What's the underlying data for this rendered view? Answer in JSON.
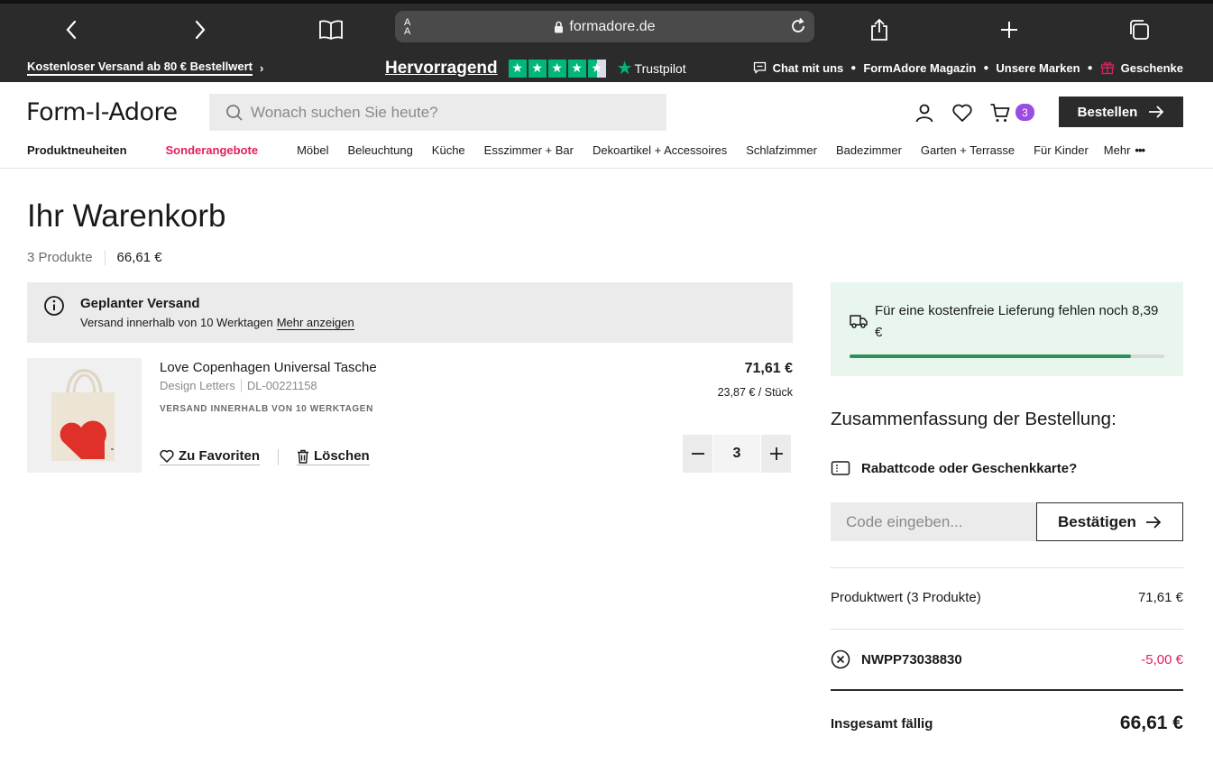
{
  "browser": {
    "url": "formadore.de",
    "aa_label": "A\nA"
  },
  "topbar": {
    "shipping_promo": "Kostenloser Versand ab 80 € Bestellwert",
    "trust_rating": "Hervorragend",
    "trust_brand": "Trustpilot",
    "links": [
      "Chat mit uns",
      "FormAdore Magazin",
      "Unsere Marken",
      "Geschenke"
    ]
  },
  "header": {
    "logo": "Form-I-Adore",
    "search_placeholder": "Wonach suchen Sie heute?",
    "cart_count": "3",
    "order_button": "Bestellen"
  },
  "nav": {
    "items": [
      "Produktneuheiten",
      "Sonderangebote",
      "Möbel",
      "Beleuchtung",
      "Küche",
      "Esszimmer + Bar",
      "Dekoartikel + Accessoires",
      "Schlafzimmer",
      "Badezimmer",
      "Garten + Terrasse",
      "Für Kinder"
    ],
    "more": "Mehr"
  },
  "cart": {
    "title": "Ihr Warenkorb",
    "count_label": "3 Produkte",
    "total": "66,61 €",
    "notice_title": "Geplanter Versand",
    "notice_text": "Versand innerhalb von 10 Werktagen",
    "notice_link": "Mehr anzeigen",
    "item": {
      "name": "Love Copenhagen Universal Tasche",
      "brand": "Design Letters",
      "sku": "DL-00221158",
      "shipping": "VERSAND INNERHALB VON 10 WERKTAGEN",
      "price": "71,61 €",
      "unit_price": "23,87 € / Stück",
      "favorite_label": "Zu Favoriten",
      "delete_label": "Löschen",
      "quantity": "3"
    }
  },
  "sidebar": {
    "free_shipping_msg": "Für eine kostenfreie Lieferung fehlen noch 8,39 €",
    "free_shipping_progress": 0.895,
    "summary_title": "Zusammenfassung der Bestellung:",
    "discount_toggle": "Rabattcode oder Geschenkkarte?",
    "code_placeholder": "Code eingeben...",
    "confirm_button": "Bestätigen",
    "product_value_label": "Produktwert (3 Produkte)",
    "product_value": "71,61 €",
    "coupon_code": "NWPP73038830",
    "coupon_value": "-5,00 €",
    "total_label": "Insgesamt fällig",
    "total_value": "66,61 €"
  },
  "colors": {
    "accent_sale": "#e1205a",
    "cart_badge": "#9a4de0",
    "trustpilot_green": "#00b67a",
    "progress_green": "#2e8f5a"
  }
}
